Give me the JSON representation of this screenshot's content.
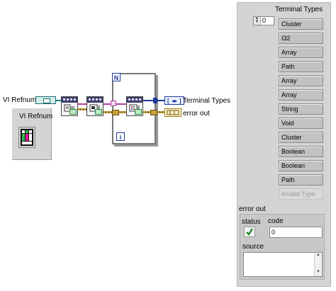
{
  "block_diagram": {
    "vi_refnum_label": "VI Refnum",
    "loop_count_label": "N",
    "loop_iteration_label": "i",
    "terminal_types_label": "Terminal Types",
    "error_out_label": "error out"
  },
  "front_panel": {
    "vi_refnum_label": "VI Refnum",
    "terminal_types": {
      "label": "Terminal Types",
      "index": "0",
      "items": [
        "Cluster",
        "I32",
        "Array",
        "Path",
        "Array",
        "Array",
        "String",
        "Void",
        "Cluster",
        "Boolean",
        "Boolean",
        "Path"
      ],
      "disabled_item": "Invalid Type"
    },
    "error_out": {
      "label": "error out",
      "status_label": "status",
      "code_label": "code",
      "code_value": "0",
      "source_label": "source",
      "source_value": ""
    }
  },
  "colors": {
    "refnum_wire": "#1f7e7a",
    "error_wire": "#c7a03b",
    "reference_wire": "#b23ea1",
    "array_wire": "#1d3a9a"
  }
}
